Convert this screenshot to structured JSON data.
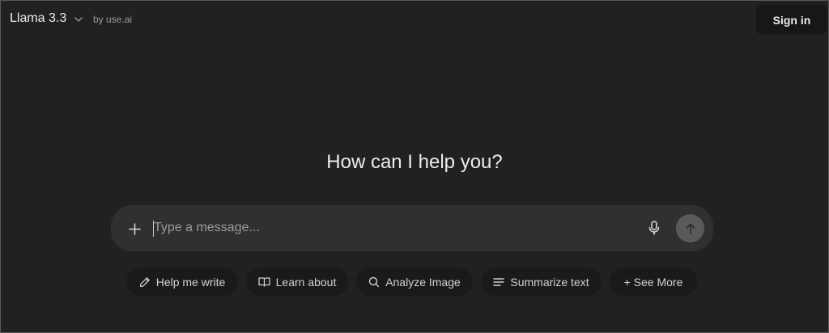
{
  "header": {
    "model_name": "Llama 3.3",
    "by_label": "by use.ai",
    "sign_in_label": "Sign in"
  },
  "main": {
    "headline": "How can I help you?"
  },
  "composer": {
    "placeholder": "Type a message..."
  },
  "suggestions": [
    {
      "label": "Help me write",
      "icon": "pencil-icon"
    },
    {
      "label": "Learn about",
      "icon": "book-icon"
    },
    {
      "label": "Analyze Image",
      "icon": "search-icon"
    },
    {
      "label": "Summarize text",
      "icon": "lines-icon"
    },
    {
      "label": "+ See More",
      "icon": ""
    }
  ],
  "colors": {
    "background": "#212121",
    "composer": "#303030",
    "chip": "#1a1a1a",
    "send_button": "#5a5a5a",
    "text": "#ececec"
  }
}
